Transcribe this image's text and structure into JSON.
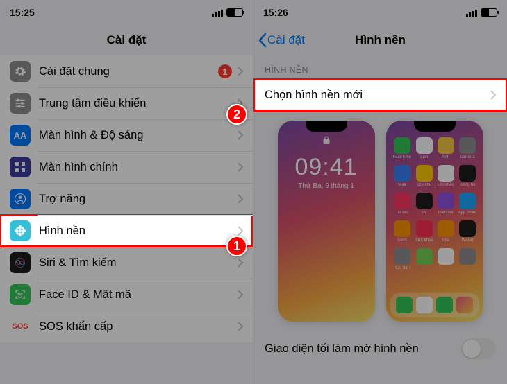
{
  "left": {
    "time": "15:25",
    "title": "Cài đặt",
    "rows": [
      {
        "key": "general",
        "label": "Cài đặt chung",
        "badge": "1",
        "iconBg": "#8e8e93",
        "iconGlyph": "gear"
      },
      {
        "key": "control",
        "label": "Trung tâm điều khiển",
        "iconBg": "#8e8e93",
        "iconGlyph": "sliders"
      },
      {
        "key": "display",
        "label": "Màn hình & Độ sáng",
        "iconBg": "#007aff",
        "iconGlyph": "aa"
      },
      {
        "key": "home",
        "label": "Màn hình chính",
        "iconBg": "#3c3c9e",
        "iconGlyph": "grid"
      },
      {
        "key": "accessibility",
        "label": "Trợ năng",
        "iconBg": "#007aff",
        "iconGlyph": "person"
      },
      {
        "key": "wallpaper",
        "label": "Hình nền",
        "iconBg": "#33c1d8",
        "iconGlyph": "flower",
        "highlight": true
      },
      {
        "key": "siri",
        "label": "Siri & Tìm kiếm",
        "iconBg": "#1c1c1e",
        "iconGlyph": "siri"
      },
      {
        "key": "faceid",
        "label": "Face ID & Mật mã",
        "iconBg": "#34c759",
        "iconGlyph": "faceid"
      },
      {
        "key": "sos",
        "label": "SOS khẩn cấp",
        "iconBg": "#ffffff",
        "iconText": "SOS",
        "iconColor": "#ff3b30"
      }
    ]
  },
  "right": {
    "time": "15:26",
    "back": "Cài đặt",
    "title": "Hình nền",
    "sectionHeader": "HÌNH NỀN",
    "chooseRow": "Chọn hình nền mới",
    "lockTime": "09:41",
    "lockDate": "Thứ Ba, 9 tháng 1",
    "toggleLabel": "Giao diện tối làm mờ hình nền",
    "apps": [
      "FaceTime",
      "Lịch",
      "Ảnh",
      "Camera",
      "Mail",
      "Ghi chú",
      "Lời nhắc",
      "Đồng hồ",
      "Tin tức",
      "TV",
      "Podcast",
      "App Store",
      "Sách",
      "Sức khỏe",
      "Nhà",
      "Wallet",
      "Cài đặt",
      "",
      "",
      ""
    ]
  },
  "markers": {
    "step1": "1",
    "step2": "2"
  },
  "appColors": [
    "#34c759",
    "#ffffff",
    "#f7c945",
    "#8e8e93",
    "#3a82f7",
    "#ffcc00",
    "#ffffff",
    "#1c1c1e",
    "#ff375f",
    "#1c1c1e",
    "#9452e0",
    "#1ea7ff",
    "#ff9500",
    "#ff2d55",
    "#ff9500",
    "#1c1c1e",
    "#8e8e93",
    "#74d158",
    "#ffffff",
    "#8e8e93"
  ]
}
